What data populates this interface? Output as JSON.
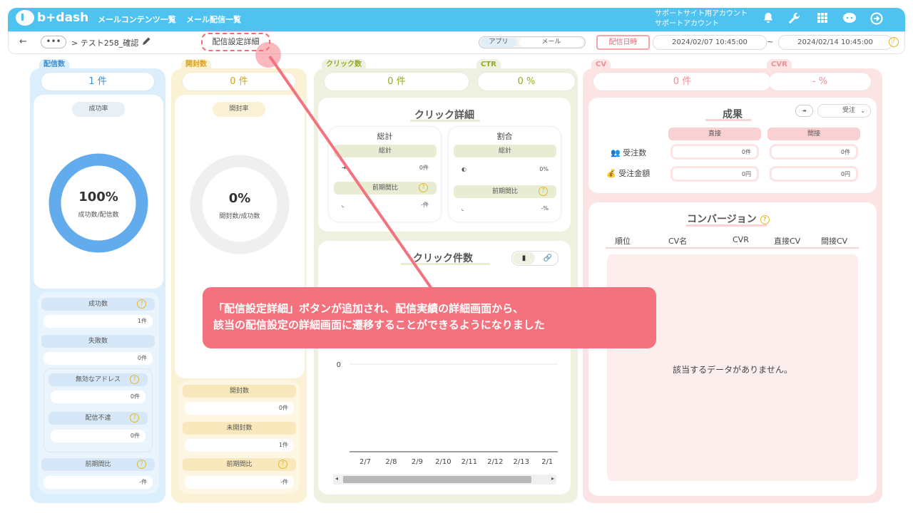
{
  "app": {
    "logo": "b+dash"
  },
  "nav": {
    "item1": "メールコンテンツ一覧",
    "item2": "メール配信一覧"
  },
  "account": {
    "line1": "サポートサイト用アカウント",
    "line2": "サポートアカウント"
  },
  "breadcrumb": {
    "back": "←",
    "dots": "•••",
    "title": "> テスト258_確認"
  },
  "config_button": "配信設定詳細",
  "toggle": {
    "app": "アプリ",
    "mail": "メール"
  },
  "date_button": "配信日時",
  "dates": {
    "start": "2024/02/07 10:45:00",
    "sep": "~",
    "end": "2024/02/14 10:45:00"
  },
  "delivery": {
    "tab": "配信数",
    "value": "1 件",
    "rate_label": "成功率",
    "donut_pct": "100%",
    "donut_sub": "成功数/配信数",
    "donut_fill": 1.0,
    "success_label": "成功数",
    "success_val": "1件",
    "fail_label": "失敗数",
    "fail_val": "0件",
    "invalid_label": "無効なアドレス",
    "invalid_val": "0件",
    "undeliv_label": "配信不達",
    "undeliv_val": "0件",
    "prev_label": "前期間比",
    "prev_val": "-件"
  },
  "open": {
    "tab": "開封数",
    "value": "0 件",
    "rate_label": "開封率",
    "donut_pct": "0%",
    "donut_sub": "開封数/成功数",
    "open_label": "開封数",
    "open_val": "0件",
    "unopen_label": "未開封数",
    "unopen_val": "1件",
    "prev_label": "前期間比",
    "prev_val": "-件"
  },
  "click": {
    "tab": "クリック数",
    "value": "0 件",
    "ctr_tab": "CTR",
    "ctr_value": "0 %",
    "detail_title": "クリック詳細",
    "total_title": "総計",
    "total_label": "総計",
    "total_val": "0件",
    "total_prev_label": "前期間比",
    "total_prev_val": "-件",
    "ratio_title": "割合",
    "ratio_label": "総計",
    "ratio_val": "0%",
    "ratio_prev_label": "前期間比",
    "ratio_prev_val": "-%",
    "chart_title": "クリック件数"
  },
  "cv": {
    "tab": "CV",
    "value": "0 件",
    "cvr_tab": "CVR",
    "cvr_value": "- %",
    "result_title": "成果",
    "select_value": "受注",
    "direct": "直接",
    "indirect": "間接",
    "orders_label": "受注数",
    "orders_direct": "0件",
    "orders_indirect": "0件",
    "amount_label": "受注金額",
    "amount_direct": "0円",
    "amount_indirect": "0円",
    "conv_title": "コンバージョン",
    "headers": [
      "順位",
      "CV名",
      "CVR",
      "直接CV",
      "間接CV"
    ],
    "empty": "該当するデータがありません。"
  },
  "callout": {
    "line1": "「配信設定詳細」ボタンが追加され、配信実績の詳細画面から、",
    "line2": "該当の配信設定の詳細画面に遷移することができるようになりました"
  },
  "chart_data": {
    "type": "bar",
    "title": "クリック件数",
    "categories": [
      "2/7",
      "2/8",
      "2/9",
      "2/10",
      "2/11",
      "2/12",
      "2/13",
      "2/1"
    ],
    "values": [
      0,
      0,
      0,
      0,
      0,
      0,
      0,
      0
    ],
    "y_ticks": [
      "0"
    ],
    "xlabel": "",
    "ylabel": ""
  }
}
